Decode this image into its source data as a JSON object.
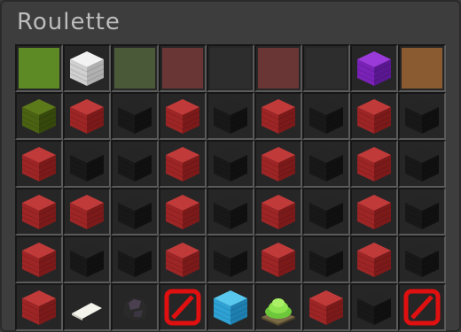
{
  "window": {
    "title": "Roulette"
  },
  "rows": [
    [
      {
        "kind": "pane",
        "type": "lime",
        "name": "lime-glass-pane"
      },
      {
        "kind": "block",
        "type": "white",
        "name": "white-wool-block"
      },
      {
        "kind": "pane",
        "type": "green",
        "name": "green-glass-pane"
      },
      {
        "kind": "pane",
        "type": "red",
        "name": "red-glass-pane"
      },
      {
        "kind": "pane",
        "type": "black",
        "name": "black-glass-pane"
      },
      {
        "kind": "pane",
        "type": "red",
        "name": "red-glass-pane"
      },
      {
        "kind": "pane",
        "type": "black",
        "name": "black-glass-pane"
      },
      {
        "kind": "block",
        "type": "purple",
        "name": "purple-wool-block"
      },
      {
        "kind": "pane",
        "type": "brown",
        "name": "brown-glass-pane"
      }
    ],
    [
      {
        "kind": "block",
        "type": "olive",
        "name": "green-wool-block"
      },
      {
        "kind": "block",
        "type": "red",
        "name": "red-wool-block"
      },
      {
        "kind": "block",
        "type": "black",
        "name": "black-wool-block"
      },
      {
        "kind": "block",
        "type": "red",
        "name": "red-wool-block"
      },
      {
        "kind": "block",
        "type": "black",
        "name": "black-wool-block"
      },
      {
        "kind": "block",
        "type": "red",
        "name": "red-wool-block"
      },
      {
        "kind": "block",
        "type": "black",
        "name": "black-wool-block"
      },
      {
        "kind": "block",
        "type": "red",
        "name": "red-wool-block"
      },
      {
        "kind": "block",
        "type": "black",
        "name": "black-wool-block"
      }
    ],
    [
      {
        "kind": "block",
        "type": "red",
        "name": "red-wool-block"
      },
      {
        "kind": "block",
        "type": "black",
        "name": "black-wool-block"
      },
      {
        "kind": "block",
        "type": "black",
        "name": "black-wool-block"
      },
      {
        "kind": "block",
        "type": "red",
        "name": "red-wool-block"
      },
      {
        "kind": "block",
        "type": "black",
        "name": "black-wool-block"
      },
      {
        "kind": "block",
        "type": "red",
        "name": "red-wool-block"
      },
      {
        "kind": "block",
        "type": "black",
        "name": "black-wool-block"
      },
      {
        "kind": "block",
        "type": "red",
        "name": "red-wool-block"
      },
      {
        "kind": "block",
        "type": "black",
        "name": "black-wool-block"
      }
    ],
    [
      {
        "kind": "block",
        "type": "red",
        "name": "red-wool-block"
      },
      {
        "kind": "block",
        "type": "red",
        "name": "red-wool-block"
      },
      {
        "kind": "block",
        "type": "black",
        "name": "black-wool-block"
      },
      {
        "kind": "block",
        "type": "red",
        "name": "red-wool-block"
      },
      {
        "kind": "block",
        "type": "black",
        "name": "black-wool-block"
      },
      {
        "kind": "block",
        "type": "red",
        "name": "red-wool-block"
      },
      {
        "kind": "block",
        "type": "black",
        "name": "black-wool-block"
      },
      {
        "kind": "block",
        "type": "red",
        "name": "red-wool-block"
      },
      {
        "kind": "block",
        "type": "black",
        "name": "black-wool-block"
      }
    ],
    [
      {
        "kind": "block",
        "type": "red",
        "name": "red-wool-block"
      },
      {
        "kind": "block",
        "type": "black",
        "name": "black-wool-block"
      },
      {
        "kind": "block",
        "type": "black",
        "name": "black-wool-block"
      },
      {
        "kind": "block",
        "type": "red",
        "name": "red-wool-block"
      },
      {
        "kind": "block",
        "type": "black",
        "name": "black-wool-block"
      },
      {
        "kind": "block",
        "type": "red",
        "name": "red-wool-block"
      },
      {
        "kind": "block",
        "type": "black",
        "name": "black-wool-block"
      },
      {
        "kind": "block",
        "type": "red",
        "name": "red-wool-block"
      },
      {
        "kind": "block",
        "type": "black",
        "name": "black-wool-block"
      }
    ],
    [
      {
        "kind": "block",
        "type": "red",
        "name": "red-bet-block"
      },
      {
        "kind": "paper",
        "type": "paper",
        "name": "paper-icon"
      },
      {
        "kind": "coal",
        "type": "coal",
        "name": "coal-icon"
      },
      {
        "kind": "barrier",
        "type": "barrier",
        "name": "barrier-icon"
      },
      {
        "kind": "block",
        "type": "cyan",
        "name": "diamond-block-icon"
      },
      {
        "kind": "slime",
        "type": "slime",
        "name": "slime-block-icon"
      },
      {
        "kind": "block",
        "type": "red",
        "name": "red-bet-block"
      },
      {
        "kind": "block",
        "type": "black",
        "name": "black-bet-block"
      },
      {
        "kind": "barrier",
        "type": "barrier",
        "name": "barrier-icon"
      }
    ]
  ],
  "colors": {
    "red": {
      "top": "#c13a3a",
      "left": "#9e2525",
      "right": "#7c1a1a"
    },
    "black": {
      "top": "#252525",
      "left": "#181818",
      "right": "#101010"
    },
    "white": {
      "top": "#f2f2f2",
      "left": "#d0d0d0",
      "right": "#b0b0b0"
    },
    "purple": {
      "top": "#9a3ad8",
      "left": "#7a22b8",
      "right": "#5a1890"
    },
    "olive": {
      "top": "#5d7a1a",
      "left": "#4a6212",
      "right": "#36480c"
    },
    "cyan": {
      "top": "#58c8ee",
      "left": "#2ea2d4",
      "right": "#1e7fb0"
    }
  }
}
